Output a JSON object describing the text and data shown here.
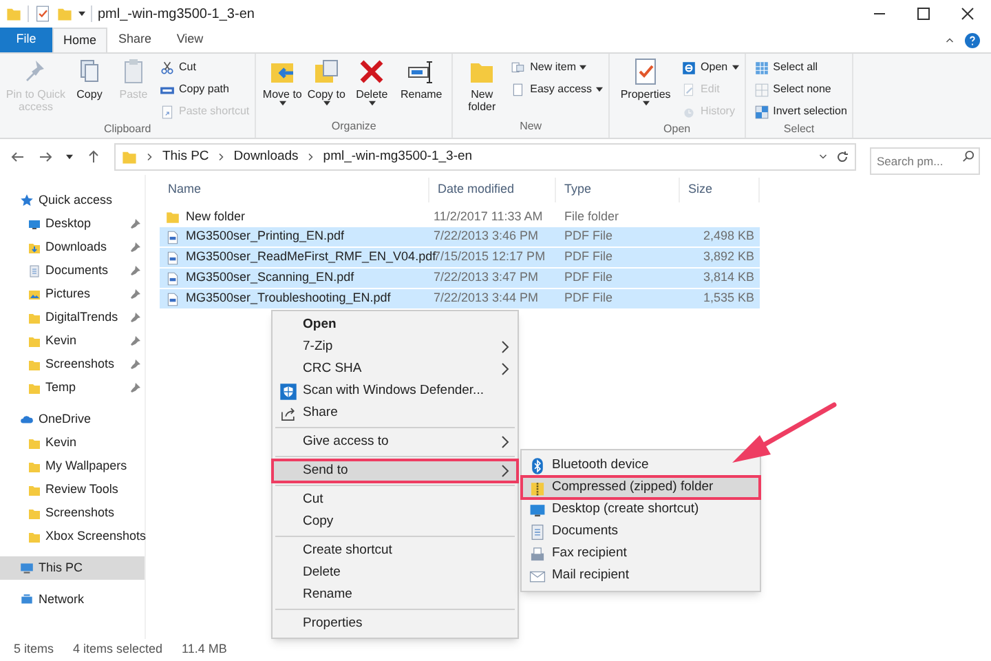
{
  "window": {
    "title": "pml_-win-mg3500-1_3-en"
  },
  "tabs": [
    {
      "label": "File",
      "kind": "file",
      "selected": false
    },
    {
      "label": "Home",
      "kind": "tab",
      "selected": true
    },
    {
      "label": "Share",
      "kind": "tab",
      "selected": false
    },
    {
      "label": "View",
      "kind": "tab",
      "selected": false
    }
  ],
  "ribbon": {
    "groups": [
      {
        "label": "Clipboard",
        "items": [
          {
            "label": "Pin to Quick access",
            "disabled": true
          },
          {
            "label": "Copy",
            "disabled": false
          },
          {
            "label": "Paste",
            "disabled": true
          },
          {
            "label": "Cut",
            "disabled": false
          },
          {
            "label": "Copy path",
            "disabled": false
          },
          {
            "label": "Paste shortcut",
            "disabled": true
          }
        ]
      },
      {
        "label": "Organize",
        "items": [
          {
            "label": "Move to",
            "disabled": false,
            "dropdown": true
          },
          {
            "label": "Copy to",
            "disabled": false,
            "dropdown": true
          },
          {
            "label": "Delete",
            "disabled": false,
            "dropdown": true
          },
          {
            "label": "Rename",
            "disabled": false,
            "dropdown": false
          }
        ]
      },
      {
        "label": "New",
        "items": [
          {
            "label": "New folder",
            "disabled": false,
            "dropdown": false
          },
          {
            "label": "New item",
            "disabled": false,
            "dropdown": true
          },
          {
            "label": "Easy access",
            "disabled": false,
            "dropdown": true
          }
        ]
      },
      {
        "label": "Open",
        "items": [
          {
            "label": "Properties",
            "disabled": false,
            "dropdown": true
          },
          {
            "label": "Open",
            "disabled": false,
            "dropdown": true
          },
          {
            "label": "Edit",
            "disabled": true
          },
          {
            "label": "History",
            "disabled": true
          }
        ]
      },
      {
        "label": "Select",
        "items": [
          {
            "label": "Select all",
            "disabled": false
          },
          {
            "label": "Select none",
            "disabled": false
          },
          {
            "label": "Invert selection",
            "disabled": false
          }
        ]
      }
    ]
  },
  "address": {
    "breadcrumbs": [
      "This PC",
      "Downloads",
      "pml_-win-mg3500-1_3-en"
    ],
    "search": {
      "placeholder": "Search pm..."
    }
  },
  "sidebar": {
    "items": [
      {
        "label": "Quick access",
        "selected": false,
        "children": [
          {
            "label": "Desktop",
            "pinned": true,
            "selected": false
          },
          {
            "label": "Downloads",
            "pinned": true,
            "selected": false
          },
          {
            "label": "Documents",
            "pinned": true,
            "selected": false
          },
          {
            "label": "Pictures",
            "pinned": true,
            "selected": false
          },
          {
            "label": "DigitalTrends",
            "pinned": true,
            "selected": false
          },
          {
            "label": "Kevin",
            "pinned": true,
            "selected": false
          },
          {
            "label": "Screenshots",
            "pinned": true,
            "selected": false
          },
          {
            "label": "Temp",
            "pinned": true,
            "selected": false
          }
        ]
      },
      {
        "label": "OneDrive",
        "selected": false,
        "children": [
          {
            "label": "Kevin",
            "selected": false
          },
          {
            "label": "My Wallpapers",
            "selected": false
          },
          {
            "label": "Review Tools",
            "selected": false
          },
          {
            "label": "Screenshots",
            "selected": false
          },
          {
            "label": "Xbox Screenshots",
            "selected": false
          }
        ]
      },
      {
        "label": "This PC",
        "selected": true
      },
      {
        "label": "Network",
        "selected": false
      }
    ]
  },
  "table": {
    "columns": [
      "Name",
      "Date modified",
      "Type",
      "Size"
    ],
    "rows": [
      {
        "name": "New folder",
        "kind": "folder",
        "date": "11/2/2017 11:33 AM",
        "type": "File folder",
        "selected": false
      },
      {
        "name": "MG3500ser_Printing_EN.pdf",
        "kind": "pdf",
        "date": "7/22/2013 3:46 PM",
        "type": "PDF File",
        "size": "2,498 KB",
        "selected": true
      },
      {
        "name": "MG3500ser_ReadMeFirst_RMF_EN_V04.pdf",
        "kind": "pdf",
        "date": "7/15/2015 12:17 PM",
        "type": "PDF File",
        "size": "3,892 KB",
        "selected": true
      },
      {
        "name": "MG3500ser_Scanning_EN.pdf",
        "kind": "pdf",
        "date": "7/22/2013 3:47 PM",
        "type": "PDF File",
        "size": "3,814 KB",
        "selected": true
      },
      {
        "name": "MG3500ser_Troubleshooting_EN.pdf",
        "kind": "pdf",
        "date": "7/22/2013 3:44 PM",
        "type": "PDF File",
        "size": "1,535 KB",
        "selected": true
      }
    ]
  },
  "context_menu": {
    "items": [
      {
        "kind": "item",
        "label": "Open",
        "bold": true,
        "submenu": false,
        "selected": false,
        "highlighted": false
      },
      {
        "kind": "item",
        "label": "7-Zip",
        "bold": false,
        "submenu": true,
        "selected": false,
        "highlighted": false
      },
      {
        "kind": "item",
        "label": "CRC SHA",
        "bold": false,
        "submenu": true,
        "selected": false,
        "highlighted": false
      },
      {
        "kind": "item",
        "label": "Scan with Windows Defender...",
        "bold": false,
        "submenu": false,
        "selected": false,
        "highlighted": false
      },
      {
        "kind": "item",
        "label": "Share",
        "bold": false,
        "submenu": false,
        "selected": false,
        "highlighted": false
      },
      {
        "kind": "separator"
      },
      {
        "kind": "item",
        "label": "Give access to",
        "bold": false,
        "submenu": true,
        "selected": false,
        "highlighted": false
      },
      {
        "kind": "separator"
      },
      {
        "kind": "item",
        "label": "Send to",
        "bold": false,
        "submenu": true,
        "selected": true,
        "highlighted": true
      },
      {
        "kind": "separator"
      },
      {
        "kind": "item",
        "label": "Cut",
        "bold": false,
        "submenu": false,
        "selected": false,
        "highlighted": false
      },
      {
        "kind": "item",
        "label": "Copy",
        "bold": false,
        "submenu": false,
        "selected": false,
        "highlighted": false
      },
      {
        "kind": "separator"
      },
      {
        "kind": "item",
        "label": "Create shortcut",
        "bold": false,
        "submenu": false,
        "selected": false,
        "highlighted": false
      },
      {
        "kind": "item",
        "label": "Delete",
        "bold": false,
        "submenu": false,
        "selected": false,
        "highlighted": false
      },
      {
        "kind": "item",
        "label": "Rename",
        "bold": false,
        "submenu": false,
        "selected": false,
        "highlighted": false
      },
      {
        "kind": "separator"
      },
      {
        "kind": "item",
        "label": "Properties",
        "bold": false,
        "submenu": false,
        "selected": false,
        "highlighted": false
      }
    ]
  },
  "submenu": {
    "items": [
      {
        "label": "Bluetooth device",
        "selected": false,
        "highlighted": false
      },
      {
        "label": "Compressed (zipped) folder",
        "selected": true,
        "highlighted": true
      },
      {
        "label": "Desktop (create shortcut)",
        "selected": false,
        "highlighted": false
      },
      {
        "label": "Documents",
        "selected": false,
        "highlighted": false
      },
      {
        "label": "Fax recipient",
        "selected": false,
        "highlighted": false
      },
      {
        "label": "Mail recipient",
        "selected": false,
        "highlighted": false
      }
    ]
  },
  "status_bar": {
    "items": [
      "5 items",
      "4 items selected",
      "11.4 MB"
    ]
  }
}
